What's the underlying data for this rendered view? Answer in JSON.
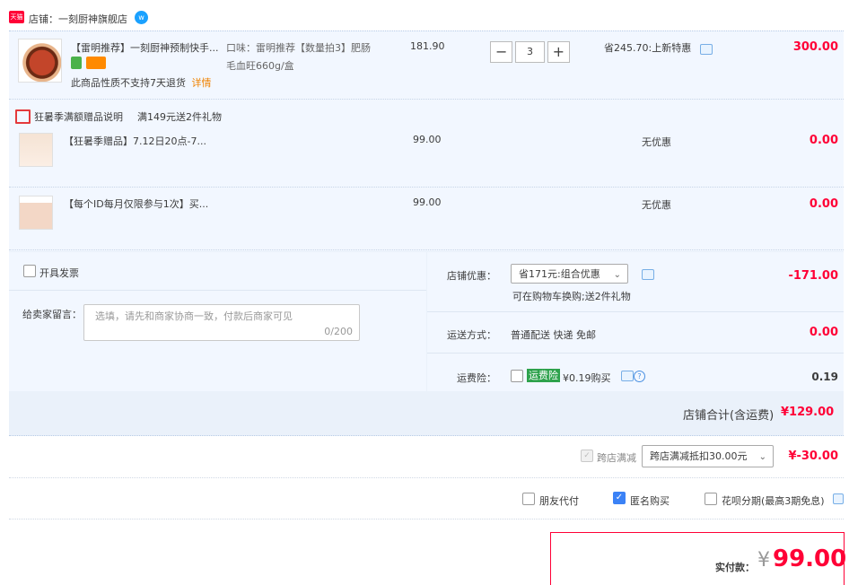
{
  "shop": {
    "badge": "天猫",
    "name": "店铺：一刻厨神旗舰店"
  },
  "main_item": {
    "title": "【雷明推荐】一刻厨神预制快手...",
    "flavor_line1": "口味：雷明推荐【数量拍3】肥肠",
    "flavor_line2": "毛血旺660g/盒",
    "unit_price": "181.90",
    "qty_minus": "−",
    "qty": "3",
    "qty_plus": "+",
    "discount": "省245.70:上新特惠",
    "amount": "300.00",
    "notice": "此商品性质不支持7天退货",
    "details": "详情"
  },
  "gift_header": {
    "label": "狂暑季满额赠品说明",
    "rule": "满149元送2件礼物"
  },
  "gifts": [
    {
      "title": "【狂暑季赠品】7.12日20点-7...",
      "price": "99.00",
      "discount": "无优惠",
      "amount": "0.00"
    },
    {
      "title": "【每个ID每月仅限参与1次】买...",
      "price": "99.00",
      "discount": "无优惠",
      "amount": "0.00"
    }
  ],
  "invoice": {
    "label": "开具发票"
  },
  "message": {
    "label": "给卖家留言：",
    "placeholder": "选填，请先和商家协商一致，付款后商家可见",
    "counter": "0/200"
  },
  "shop_discount": {
    "label": "店铺优惠：",
    "selected": "省171元:组合优惠",
    "note": "可在购物车换购;送2件礼物",
    "amount": "-171.00"
  },
  "shipping": {
    "label": "运送方式：",
    "value": "普通配送 快递 免邮",
    "amount": "0.00"
  },
  "insurance": {
    "label": "运费险：",
    "tag": "运费险",
    "price": "¥0.19购买",
    "amount": "0.19"
  },
  "shop_total": {
    "label": "店铺合计(含运费)",
    "amount": "¥129.00"
  },
  "cross_store": {
    "label": "跨店满减",
    "selected": "跨店满减抵扣30.00元",
    "amount": "¥-30.00"
  },
  "options": {
    "friend_pay": "朋友代付",
    "anonymous": "匿名购买",
    "huabei": "花呗分期(最高3期免息)"
  },
  "payment": {
    "label": "实付款：",
    "currency": "¥",
    "amount": "99.00"
  },
  "colors": {
    "accent_red": "#ff0036",
    "panel_blue": "#f2f7ff",
    "checkbox_blue": "#3b82f6",
    "tag_green": "#2ea24c"
  }
}
